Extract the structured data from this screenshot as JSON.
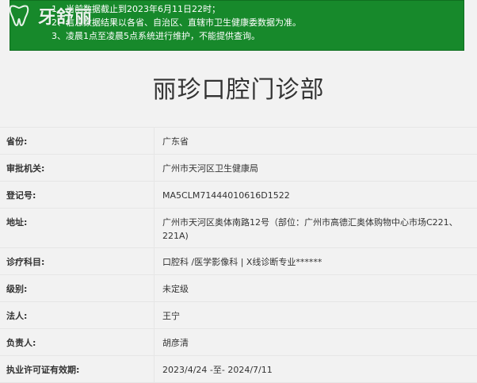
{
  "notice": {
    "logo_text": "牙舒丽",
    "lines": [
      "1、当前数据截止到2023年6月11日22时；",
      "2、信息数据结果以各省、自治区、直辖市卫生健康委数据为准。",
      "3、凌晨1点至凌晨5点系统进行维护，不能提供查询。"
    ]
  },
  "page_title": "丽珍口腔门诊部",
  "fields": [
    {
      "label": "省份:",
      "value": "广东省"
    },
    {
      "label": "审批机关:",
      "value": "广州市天河区卫生健康局"
    },
    {
      "label": "登记号:",
      "value": "MA5CLM71444010616D1522"
    },
    {
      "label": "地址:",
      "value": "广州市天河区奥体南路12号（部位：广州市高德汇奥体购物中心市场C221、221A)"
    },
    {
      "label": "诊疗科目:",
      "value": "口腔科 /医学影像科 | X线诊断专业******"
    },
    {
      "label": "级别:",
      "value": "未定级"
    },
    {
      "label": "法人:",
      "value": "王宁"
    },
    {
      "label": "负责人:",
      "value": "胡彦清"
    },
    {
      "label": "执业许可证有效期:",
      "value": "2023/4/24 -至- 2024/7/11"
    }
  ]
}
